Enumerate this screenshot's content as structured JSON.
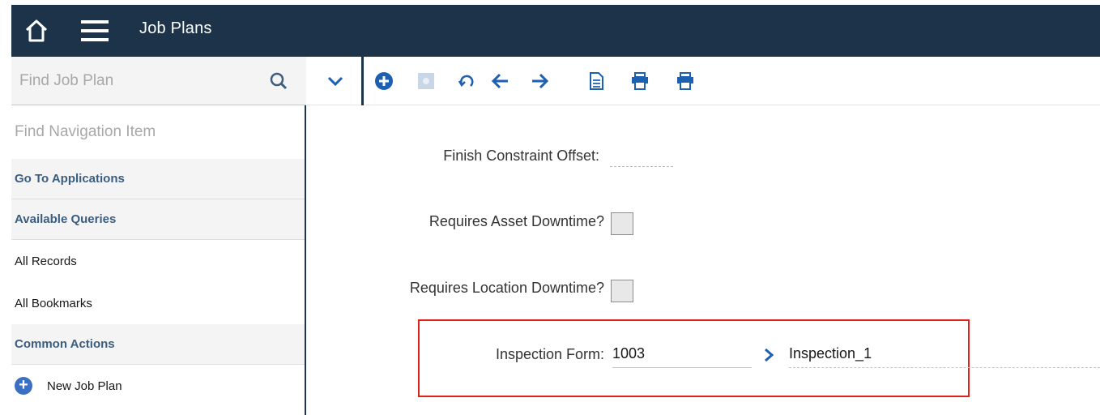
{
  "header": {
    "title": "Job Plans"
  },
  "toolbar": {
    "search_placeholder": "Find Job Plan",
    "icons": [
      "search-icon",
      "chevron-down-icon",
      "add-icon",
      "disabled-record-icon",
      "undo-icon",
      "arrow-left-icon",
      "arrow-right-icon",
      "document-icon",
      "print-icon",
      "print-icon"
    ]
  },
  "sidebar": {
    "nav_search_placeholder": "Find Navigation Item",
    "sections": {
      "go_to_applications": "Go To Applications",
      "available_queries": "Available Queries",
      "common_actions": "Common Actions"
    },
    "queries": [
      "All Records",
      "All Bookmarks"
    ],
    "actions": [
      "New Job Plan"
    ]
  },
  "form": {
    "finish_constraint_offset": {
      "label": "Finish Constraint Offset:",
      "value": ""
    },
    "requires_asset_downtime": {
      "label": "Requires Asset Downtime?",
      "checked": false
    },
    "requires_location_downtime": {
      "label": "Requires Location Downtime?",
      "checked": false
    },
    "inspection_form": {
      "label": "Inspection Form:",
      "value": "1003",
      "description": "Inspection_1"
    }
  },
  "colors": {
    "header_bg": "#1d3349",
    "accent": "#3a6fc4",
    "highlight_border": "#e0201b"
  }
}
